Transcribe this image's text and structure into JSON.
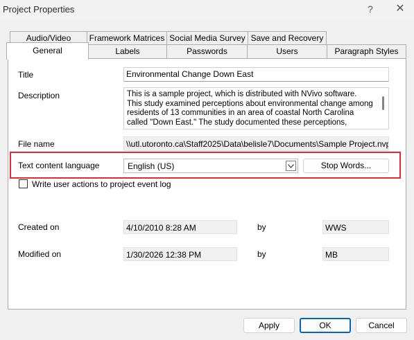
{
  "window": {
    "title": "Project Properties",
    "help_glyph": "?",
    "close_glyph": "✕"
  },
  "tabs": {
    "back_row": [
      "Audio/Video",
      "Framework Matrices",
      "Social Media Survey",
      "Save and Recovery"
    ],
    "front_row": [
      "General",
      "Labels",
      "Passwords",
      "Users",
      "Paragraph Styles"
    ],
    "active": "General"
  },
  "general": {
    "title_label": "Title",
    "title_value": "Environmental Change Down East",
    "description_label": "Description",
    "description_value": "This is a sample project, which is distributed with NVivo software. This study examined perceptions about environmental change among residents of 13 communities in an area of coastal North Carolina called \"Down East.\" The study documented these perceptions, brought together stakeholders on all",
    "filename_label": "File name",
    "filename_value": "\\\\utl.utoronto.ca\\Staff2025\\Data\\belisle7\\Documents\\Sample Project.nvp",
    "language_label": "Text content language",
    "language_value": "English (US)",
    "stop_words_label": "Stop Words...",
    "write_log_label": "Write user actions to project event log",
    "write_log_checked": false,
    "created_label": "Created on",
    "created_value": "4/10/2010 8:28 AM",
    "created_by_label": "by",
    "created_by_value": "WWS",
    "modified_label": "Modified on",
    "modified_value": "1/30/2026 12:38 PM",
    "modified_by_label": "by",
    "modified_by_value": "MB"
  },
  "footer": {
    "apply_label": "Apply",
    "ok_label": "OK",
    "cancel_label": "Cancel"
  },
  "colors": {
    "highlight": "#e8282d",
    "primary_button_border": "#0067c0"
  }
}
